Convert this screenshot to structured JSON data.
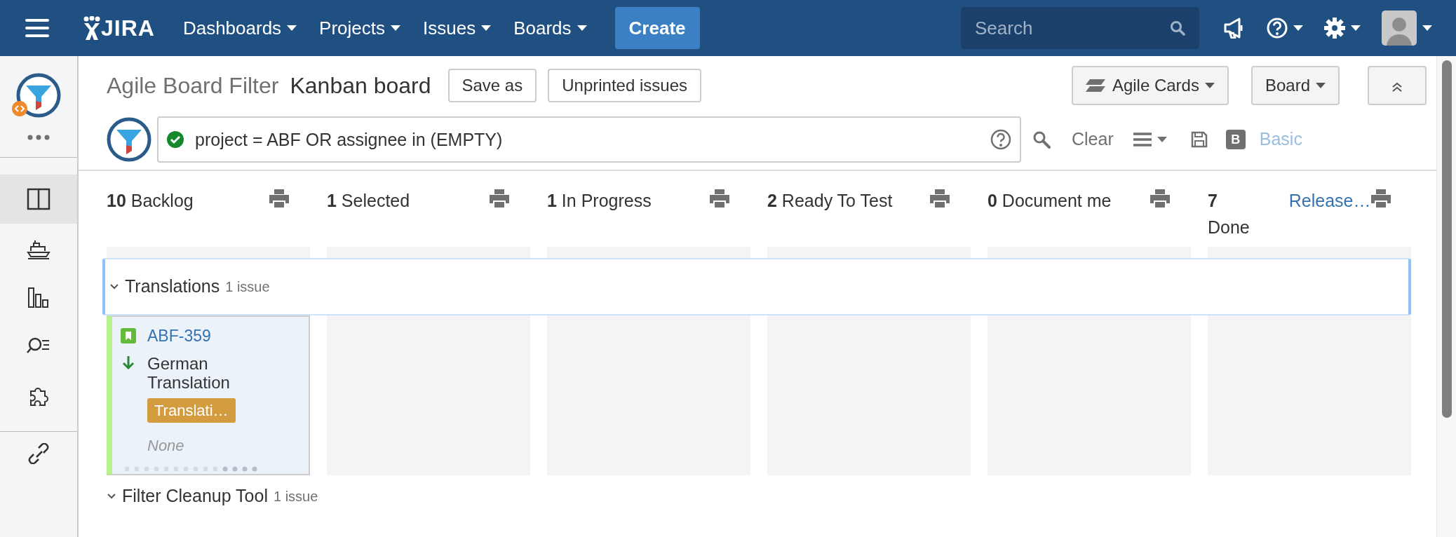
{
  "nav": {
    "logo": "JIRA",
    "menus": [
      {
        "label": "Dashboards"
      },
      {
        "label": "Projects"
      },
      {
        "label": "Issues"
      },
      {
        "label": "Boards"
      }
    ],
    "create": "Create",
    "search_placeholder": "Search"
  },
  "sidebar": {
    "items": [
      {
        "kind": "board",
        "selected": true
      },
      {
        "kind": "releases",
        "selected": false
      },
      {
        "kind": "reports",
        "selected": false
      },
      {
        "kind": "issues",
        "selected": false
      },
      {
        "kind": "addons",
        "selected": false
      }
    ]
  },
  "header": {
    "project": "Agile Board Filter",
    "board": "Kanban board",
    "buttons": [
      "Save as",
      "Unprinted issues"
    ],
    "agile_cards": "Agile Cards",
    "board_menu": "Board"
  },
  "query": {
    "value": "project = ABF OR assignee in (EMPTY)",
    "valid": true
  },
  "query_tools": {
    "clear": "Clear",
    "bold_key": "B",
    "basic": "Basic"
  },
  "columns": [
    {
      "count": "10",
      "name": "Backlog"
    },
    {
      "count": "1",
      "name": "Selected"
    },
    {
      "count": "1",
      "name": "In Progress"
    },
    {
      "count": "2",
      "name": "Ready To Test"
    },
    {
      "count": "0",
      "name": "Document me"
    },
    {
      "count": "7",
      "name": "Done",
      "release": "Release…"
    }
  ],
  "swimlanes": [
    {
      "title": "Translations",
      "count": "1 issue",
      "expanded": true,
      "cells": [
        {
          "cards": [
            {
              "key": "ABF-359",
              "summary": "German Translation",
              "label": "Translati…",
              "assignee": "None"
            }
          ]
        },
        {},
        {},
        {},
        {},
        {}
      ]
    },
    {
      "title": "Filter Cleanup Tool",
      "count": "1 issue",
      "expanded": true
    }
  ]
}
